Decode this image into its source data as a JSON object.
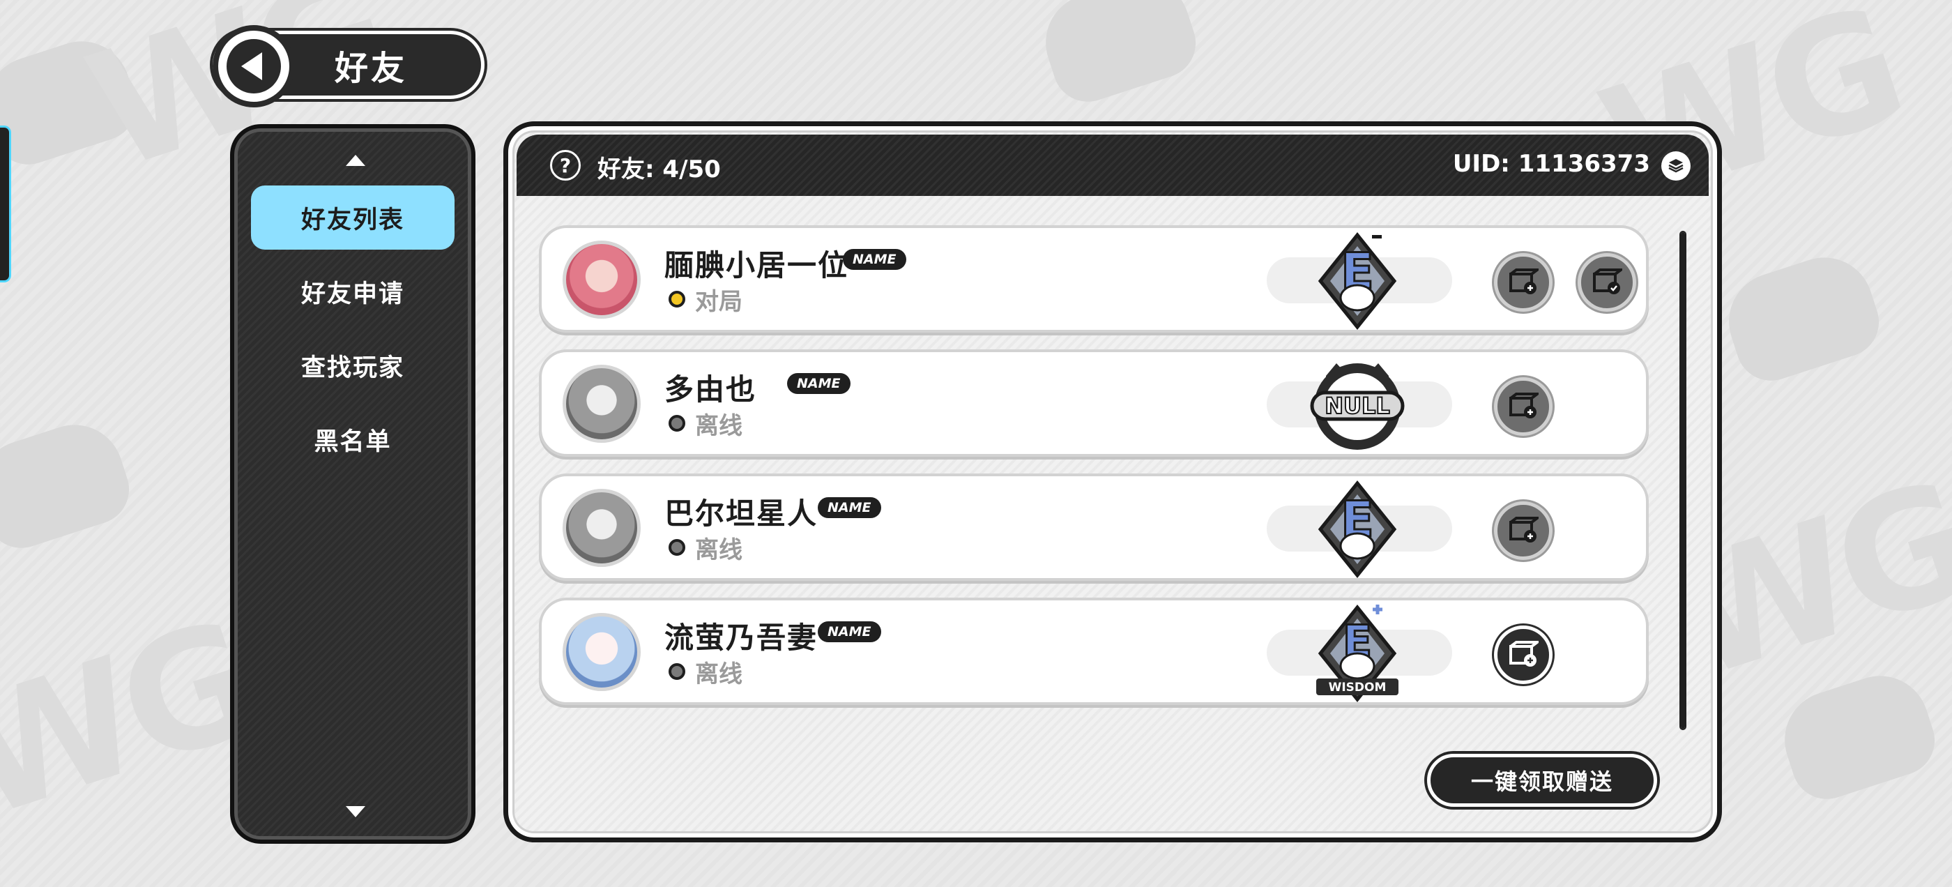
{
  "header": {
    "title": "好友"
  },
  "nav": {
    "items": [
      {
        "label": "好友列表",
        "active": true
      },
      {
        "label": "好友申请",
        "active": false
      },
      {
        "label": "查找玩家",
        "active": false
      },
      {
        "label": "黑名单",
        "active": false
      }
    ]
  },
  "panel": {
    "friend_count_label": "好友: 4/50",
    "uid_label": "UID: 11136373"
  },
  "friends": [
    {
      "name": "腼腆小居一位",
      "badge": "NAME",
      "status": "对局",
      "status_color": "#f3c623",
      "rank": "E",
      "rank_mod": "-",
      "gift_buttons": 2
    },
    {
      "name": "多由也",
      "badge": "NAME",
      "status": "离线",
      "status_color": "#7a7a7a",
      "rank": "NULL",
      "rank_mod": "",
      "gift_buttons": 1
    },
    {
      "name": "巴尔坦星人",
      "badge": "NAME",
      "status": "离线",
      "status_color": "#7a7a7a",
      "rank": "E",
      "rank_mod": "",
      "gift_buttons": 1
    },
    {
      "name": "流萤乃吾妻",
      "badge": "NAME",
      "status": "离线",
      "status_color": "#7a7a7a",
      "rank": "E",
      "rank_mod": "+",
      "rank_ribbon": "WISDOM",
      "gift_buttons": 1
    }
  ],
  "footer": {
    "claim_label": "一键领取赠送"
  },
  "colors": {
    "accent": "#8ee0ff",
    "dark": "#262626",
    "panel": "#f1f1f1"
  }
}
